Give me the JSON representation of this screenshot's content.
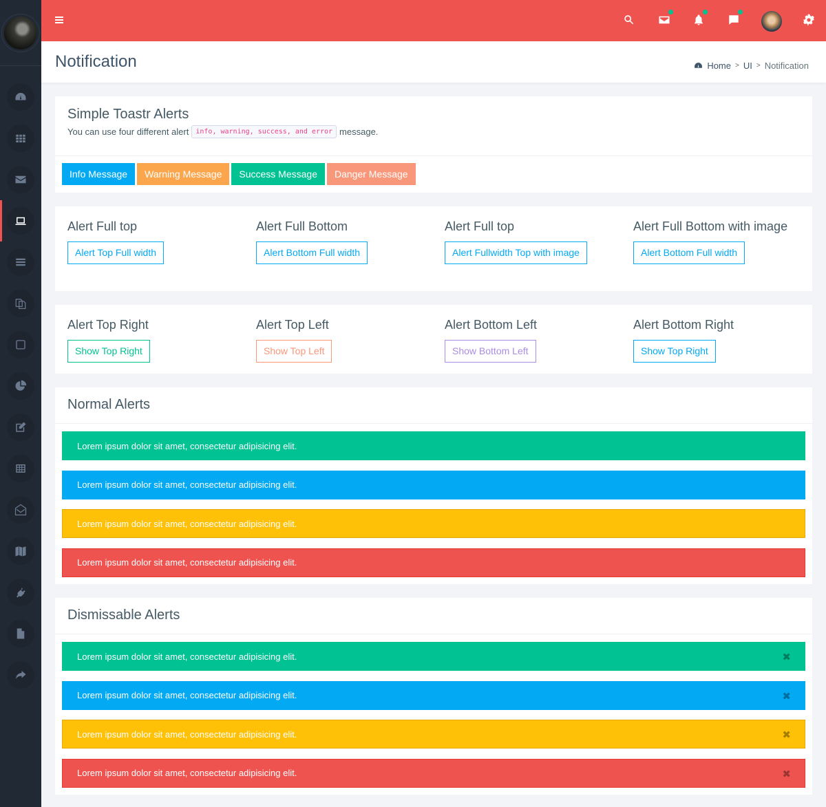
{
  "sidebar": {
    "items": [
      {
        "icon": "dashboard-icon",
        "active": false
      },
      {
        "icon": "apps-grid-icon",
        "active": false
      },
      {
        "icon": "envelope-icon",
        "active": false
      },
      {
        "icon": "laptop-icon",
        "active": true
      },
      {
        "icon": "list-icon",
        "active": false
      },
      {
        "icon": "copy-icon",
        "active": false
      },
      {
        "icon": "square-icon",
        "active": false
      },
      {
        "icon": "pie-chart-icon",
        "active": false
      },
      {
        "icon": "edit-icon",
        "active": false
      },
      {
        "icon": "table-icon",
        "active": false
      },
      {
        "icon": "envelope-open-icon",
        "active": false
      },
      {
        "icon": "map-icon",
        "active": false
      },
      {
        "icon": "plug-icon",
        "active": false
      },
      {
        "icon": "file-icon",
        "active": false
      },
      {
        "icon": "share-icon",
        "active": false
      }
    ]
  },
  "topbar": {
    "accent": "#ef5350",
    "icons": [
      "search-icon",
      "mail-icon",
      "bell-icon",
      "chat-icon",
      "user-avatar",
      "gear-icon"
    ]
  },
  "page": {
    "title": "Notification",
    "breadcrumb": [
      "Home",
      "UI",
      "Notification"
    ]
  },
  "toastr": {
    "title": "Simple Toastr Alerts",
    "subtitle_pre": "You can use four different alert",
    "subtitle_code": "info, warning, success, and error",
    "subtitle_post": "message.",
    "buttons": [
      {
        "label": "Info Message",
        "color": "#03a9f3"
      },
      {
        "label": "Warning Message",
        "color": "#fba64d"
      },
      {
        "label": "Success Message",
        "color": "#00c292"
      },
      {
        "label": "Danger Message",
        "color": "#f9977a"
      }
    ]
  },
  "fullwidth": [
    {
      "title": "Alert Full top",
      "button": "Alert Top Full width",
      "color": "#03a9f3"
    },
    {
      "title": "Alert Full Bottom",
      "button": "Alert Bottom Full width",
      "color": "#03a9f3"
    },
    {
      "title": "Alert Full top",
      "button": "Alert Fullwidth Top with image",
      "color": "#03a9f3"
    },
    {
      "title": "Alert Full Bottom with image",
      "button": "Alert Bottom Full width",
      "color": "#03a9f3"
    }
  ],
  "positions": [
    {
      "title": "Alert Top Right",
      "button": "Show Top Right",
      "color": "#00c292"
    },
    {
      "title": "Alert Top Left",
      "button": "Show Top Left",
      "color": "#f9977a"
    },
    {
      "title": "Alert Bottom Left",
      "button": "Show Bottom Left",
      "color": "#ab8ce4"
    },
    {
      "title": "Alert Bottom Right",
      "button": "Show Top Right",
      "color": "#03a9f3"
    }
  ],
  "normal_alerts": {
    "title": "Normal Alerts",
    "items": [
      {
        "text": "Lorem ipsum dolor sit amet, consectetur adipisicing elit.",
        "color": "#00c292",
        "border": "#00c292"
      },
      {
        "text": "Lorem ipsum dolor sit amet, consectetur adipisicing elit.",
        "color": "#03a9f3",
        "border": "#03a9f3"
      },
      {
        "text": "Lorem ipsum dolor sit amet, consectetur adipisicing elit.",
        "color": "#fec107",
        "border": "#e5a90a"
      },
      {
        "text": "Lorem ipsum dolor sit amet, consectetur adipisicing elit.",
        "color": "#ef5350",
        "border": "#e53935"
      }
    ]
  },
  "dismissable_alerts": {
    "title": "Dismissable Alerts",
    "close_glyph": "✖",
    "items": [
      {
        "text": "Lorem ipsum dolor sit amet, consectetur adipisicing elit.",
        "color": "#00c292",
        "border": "#00c292"
      },
      {
        "text": "Lorem ipsum dolor sit amet, consectetur adipisicing elit.",
        "color": "#03a9f3",
        "border": "#03a9f3"
      },
      {
        "text": "Lorem ipsum dolor sit amet, consectetur adipisicing elit.",
        "color": "#fec107",
        "border": "#e5a90a"
      },
      {
        "text": "Lorem ipsum dolor sit amet, consectetur adipisicing elit.",
        "color": "#ef5350",
        "border": "#e53935"
      }
    ]
  }
}
